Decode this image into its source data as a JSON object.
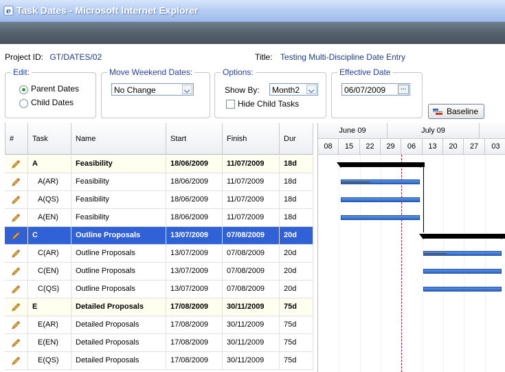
{
  "window": {
    "title": "Task Dates - Microsoft Internet Explorer"
  },
  "project": {
    "id_label": "Project ID:",
    "id_value": "GT/DATES/02",
    "title_label": "Title:",
    "title_value": "Testing Multi-Discipline Date Entry"
  },
  "edit": {
    "legend": "Edit:",
    "options": [
      "Parent Dates",
      "Child Dates"
    ],
    "selected": "Parent Dates"
  },
  "weekend": {
    "legend": "Move Weekend Dates:",
    "value": "No Change"
  },
  "options": {
    "legend": "Options:",
    "show_by_label": "Show By:",
    "show_by_value": "Month2",
    "hide_child_label": "Hide Child Tasks"
  },
  "effective": {
    "legend": "Effective Date",
    "value": "06/07/2009",
    "ellipsis": "..."
  },
  "baseline_button": "Baseline",
  "columns": {
    "num": "#",
    "task": "Task",
    "name": "Name",
    "start": "Start",
    "finish": "Finish",
    "dur": "Dur"
  },
  "rows": [
    {
      "task": "A",
      "name": "Feasibility",
      "start": "18/06/2009",
      "finish": "11/07/2009",
      "dur": "18d",
      "type": "parent"
    },
    {
      "task": "A(AR)",
      "name": "Feasibility",
      "start": "18/06/2009",
      "finish": "11/07/2009",
      "dur": "18d",
      "type": "child"
    },
    {
      "task": "A(QS)",
      "name": "Feasibility",
      "start": "18/06/2009",
      "finish": "11/07/2009",
      "dur": "18d",
      "type": "child"
    },
    {
      "task": "A(EN)",
      "name": "Feasibility",
      "start": "18/06/2009",
      "finish": "11/07/2009",
      "dur": "18d",
      "type": "child"
    },
    {
      "task": "C",
      "name": "Outline Proposals",
      "start": "13/07/2009",
      "finish": "07/08/2009",
      "dur": "20d",
      "type": "selected"
    },
    {
      "task": "C(AR)",
      "name": "Outline Proposals",
      "start": "13/07/2009",
      "finish": "07/08/2009",
      "dur": "20d",
      "type": "child"
    },
    {
      "task": "C(EN)",
      "name": "Outline Proposals",
      "start": "13/07/2009",
      "finish": "07/08/2009",
      "dur": "20d",
      "type": "child"
    },
    {
      "task": "C(QS)",
      "name": "Outline Proposals",
      "start": "13/07/2009",
      "finish": "07/08/2009",
      "dur": "20d",
      "type": "child"
    },
    {
      "task": "E",
      "name": "Detailed Proposals",
      "start": "17/08/2009",
      "finish": "30/11/2009",
      "dur": "75d",
      "type": "parent"
    },
    {
      "task": "E(AR)",
      "name": "Detailed Proposals",
      "start": "17/08/2009",
      "finish": "30/11/2009",
      "dur": "75d",
      "type": "child"
    },
    {
      "task": "E(EN)",
      "name": "Detailed Proposals",
      "start": "17/08/2009",
      "finish": "30/11/2009",
      "dur": "75d",
      "type": "child"
    },
    {
      "task": "E(QS)",
      "name": "Detailed Proposals",
      "start": "17/08/2009",
      "finish": "30/11/2009",
      "dur": "75d",
      "type": "child"
    }
  ],
  "gantt": {
    "months": [
      "June 09",
      "July 09"
    ],
    "weeks": [
      "08",
      "15",
      "22",
      "29",
      "06",
      "13",
      "20",
      "27",
      "03"
    ]
  },
  "colors": {
    "selected_row": "#3161d6",
    "parent_row": "#fffff0",
    "link_blue": "#1b3c8a",
    "legend_blue": "#2240a5",
    "bar_blue": "#2d64c4"
  }
}
